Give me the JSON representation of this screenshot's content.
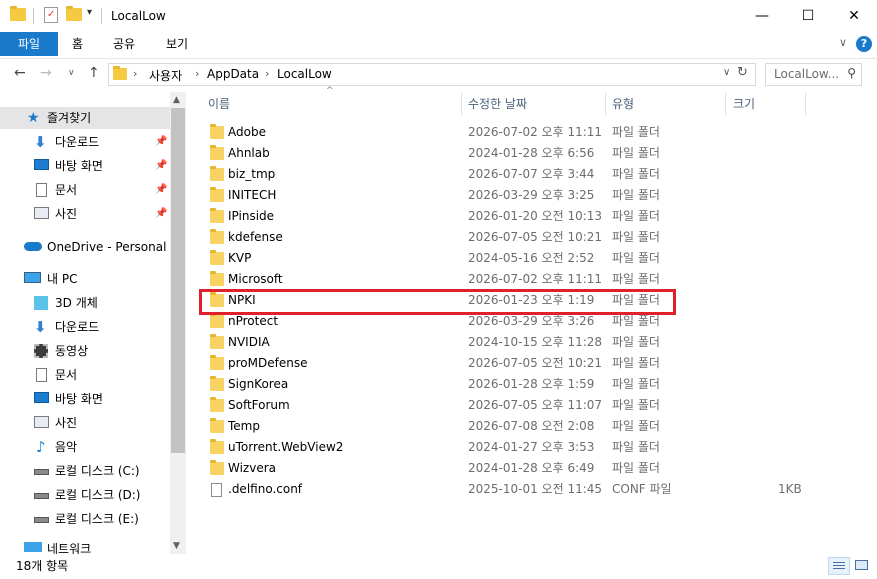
{
  "window": {
    "title": "LocalLow",
    "minimize": "—",
    "maximize": "☐",
    "close": "✕"
  },
  "ribbon": {
    "tabs": [
      "파일",
      "홈",
      "공유",
      "보기"
    ],
    "help": "?"
  },
  "address": {
    "crumbs": [
      "사용자",
      "AppData",
      "LocalLow"
    ],
    "search_placeholder": "LocalLow..."
  },
  "nav_pane": {
    "items": [
      {
        "label": "즐겨찾기",
        "icon": "star-icon"
      },
      {
        "label": "다운로드",
        "icon": "download-arrow-icon",
        "pinned": true
      },
      {
        "label": "바탕 화면",
        "icon": "desktop-icon",
        "pinned": true
      },
      {
        "label": "문서",
        "icon": "document-icon",
        "pinned": true
      },
      {
        "label": "사진",
        "icon": "pictures-icon",
        "pinned": true
      },
      {
        "label": "OneDrive - Personal",
        "icon": "cloud-icon"
      },
      {
        "label": "내 PC",
        "icon": "computer-icon"
      },
      {
        "label": "3D 개체",
        "icon": "cube-icon"
      },
      {
        "label": "다운로드",
        "icon": "download-arrow-icon"
      },
      {
        "label": "동영상",
        "icon": "video-icon"
      },
      {
        "label": "문서",
        "icon": "document-icon"
      },
      {
        "label": "바탕 화면",
        "icon": "desktop-icon"
      },
      {
        "label": "사진",
        "icon": "pictures-icon"
      },
      {
        "label": "음악",
        "icon": "music-note-icon"
      },
      {
        "label": "로컬 디스크 (C:)",
        "icon": "drive-icon"
      },
      {
        "label": "로컬 디스크 (D:)",
        "icon": "drive-icon"
      },
      {
        "label": "로컬 디스크 (E:)",
        "icon": "drive-icon"
      },
      {
        "label": "네트워크",
        "icon": "network-icon"
      }
    ]
  },
  "columns": {
    "name": "이름",
    "date": "수정한 날짜",
    "type": "유형",
    "size": "크기"
  },
  "files": [
    {
      "name": "Adobe",
      "date": "2026-07-02 오후 11:11",
      "type": "파일 폴더",
      "size": ""
    },
    {
      "name": "Ahnlab",
      "date": "2024-01-28 오후 6:56",
      "type": "파일 폴더",
      "size": ""
    },
    {
      "name": "biz_tmp",
      "date": "2026-07-07 오후 3:44",
      "type": "파일 폴더",
      "size": ""
    },
    {
      "name": "INITECH",
      "date": "2026-03-29 오후 3:25",
      "type": "파일 폴더",
      "size": ""
    },
    {
      "name": "IPinside",
      "date": "2026-01-20 오전 10:13",
      "type": "파일 폴더",
      "size": ""
    },
    {
      "name": "kdefense",
      "date": "2026-07-05 오전 10:21",
      "type": "파일 폴더",
      "size": ""
    },
    {
      "name": "KVP",
      "date": "2024-05-16 오전 2:52",
      "type": "파일 폴더",
      "size": ""
    },
    {
      "name": "Microsoft",
      "date": "2026-07-02 오후 11:11",
      "type": "파일 폴더",
      "size": ""
    },
    {
      "name": "NPKI",
      "date": "2026-01-23 오후 1:19",
      "type": "파일 폴더",
      "size": ""
    },
    {
      "name": "nProtect",
      "date": "2026-03-29 오후 3:26",
      "type": "파일 폴더",
      "size": ""
    },
    {
      "name": "NVIDIA",
      "date": "2024-10-15 오후 11:28",
      "type": "파일 폴더",
      "size": ""
    },
    {
      "name": "proMDefense",
      "date": "2026-07-05 오전 10:21",
      "type": "파일 폴더",
      "size": ""
    },
    {
      "name": "SignKorea",
      "date": "2026-01-28 오후 1:59",
      "type": "파일 폴더",
      "size": ""
    },
    {
      "name": "SoftForum",
      "date": "2026-07-05 오후 11:07",
      "type": "파일 폴더",
      "size": ""
    },
    {
      "name": "Temp",
      "date": "2026-07-08 오전 2:08",
      "type": "파일 폴더",
      "size": ""
    },
    {
      "name": "uTorrent.WebView2",
      "date": "2024-01-27 오후 3:53",
      "type": "파일 폴더",
      "size": ""
    },
    {
      "name": "Wizvera",
      "date": "2024-01-28 오후 6:49",
      "type": "파일 폴더",
      "size": ""
    },
    {
      "name": ".delfino.conf",
      "date": "2025-10-01 오전 11:45",
      "type": "CONF 파일",
      "size": "1KB"
    }
  ],
  "status": {
    "item_count": "18개 항목"
  },
  "colors": {
    "accent": "#1979ca",
    "highlight_box": "#e0202a",
    "folder": "#f8d364"
  }
}
